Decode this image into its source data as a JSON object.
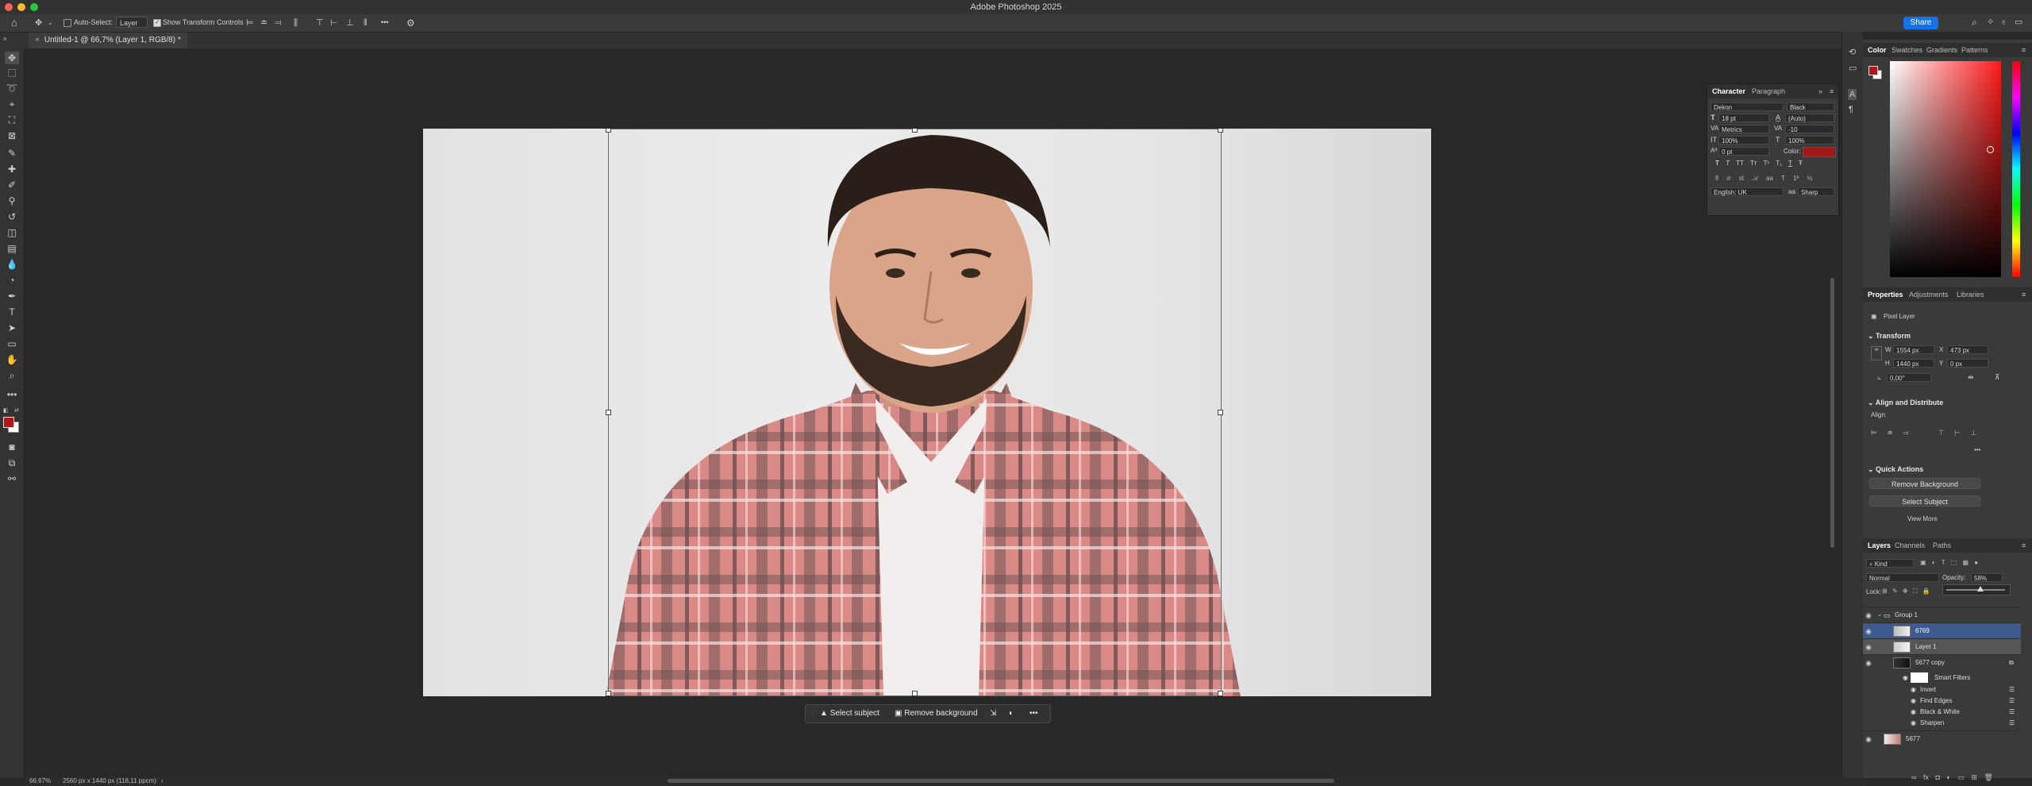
{
  "window": {
    "title": "Adobe Photoshop 2025"
  },
  "options_bar": {
    "auto_select_label": "Auto-Select:",
    "auto_select_value": "Layer",
    "show_transform_label": "Show Transform Controls",
    "more_label": "•••",
    "share_label": "Share"
  },
  "document": {
    "tab_title": "Untitled-1 @ 66,7% (Layer 1, RGB/8) *"
  },
  "context_bar": {
    "select_subject": "Select subject",
    "remove_background": "Remove background",
    "more": "•••"
  },
  "status": {
    "zoom": "66.67%",
    "doc_info": "2560 px x 1440 px (118,11 ppcm)",
    "arrow": "›"
  },
  "character_panel": {
    "tabs": [
      "Character",
      "Paragraph"
    ],
    "font_family": "Dekon",
    "font_style": "Black",
    "font_size": "18 pt",
    "leading": "(Auto)",
    "kerning": "Metrics",
    "tracking": "-10",
    "vertical_scale": "100%",
    "horizontal_scale": "100%",
    "baseline_shift": "0 pt",
    "color_label": "Color:",
    "text_color": "#a01818",
    "style_buttons": [
      "T",
      "T",
      "TT",
      "Tт",
      "T¹",
      "T₁",
      "T",
      "Ŧ"
    ],
    "language": "English: UK",
    "antialias": "Sharp",
    "antialias_prefix": "aa"
  },
  "color_panel": {
    "tabs": [
      "Color",
      "Swatches",
      "Gradients",
      "Patterns"
    ],
    "fg_color": "#b01818",
    "bg_color": "#ffffff"
  },
  "properties_panel": {
    "tabs": [
      "Properties",
      "Adjustments",
      "Libraries"
    ],
    "layer_type": "Pixel Layer",
    "transform_title": "Transform",
    "w_label": "W",
    "w_value": "1554 px",
    "h_label": "H",
    "h_value": "1440 px",
    "x_label": "X",
    "x_value": "473 px",
    "y_label": "Y",
    "y_value": "0 px",
    "angle": "0,00°",
    "flip_h": "⇹",
    "align_title": "Align and Distribute",
    "align_label": "Align:",
    "more": "•••",
    "quick_actions_title": "Quick Actions",
    "remove_background": "Remove Background",
    "select_subject": "Select Subject",
    "view_more": "View More"
  },
  "layers_panel": {
    "tabs": [
      "Layers",
      "Channels",
      "Paths"
    ],
    "kind_label": "Kind",
    "blend_mode": "Normal",
    "opacity_label": "Opacity:",
    "opacity_value": "58%",
    "lock_label": "Lock:",
    "layers": [
      {
        "name": "Group 1",
        "type": "group"
      },
      {
        "name": "6769",
        "type": "layer",
        "selected": true
      },
      {
        "name": "Layer 1",
        "type": "layer",
        "selected": true
      },
      {
        "name": "5677 copy",
        "type": "smart"
      },
      {
        "name": "Smart Filters",
        "type": "filters"
      },
      {
        "name": "Invert",
        "type": "filter"
      },
      {
        "name": "Find Edges",
        "type": "filter"
      },
      {
        "name": "Black & White",
        "type": "filter"
      },
      {
        "name": "Sharpen",
        "type": "filter"
      },
      {
        "name": "5677",
        "type": "layer"
      }
    ]
  }
}
